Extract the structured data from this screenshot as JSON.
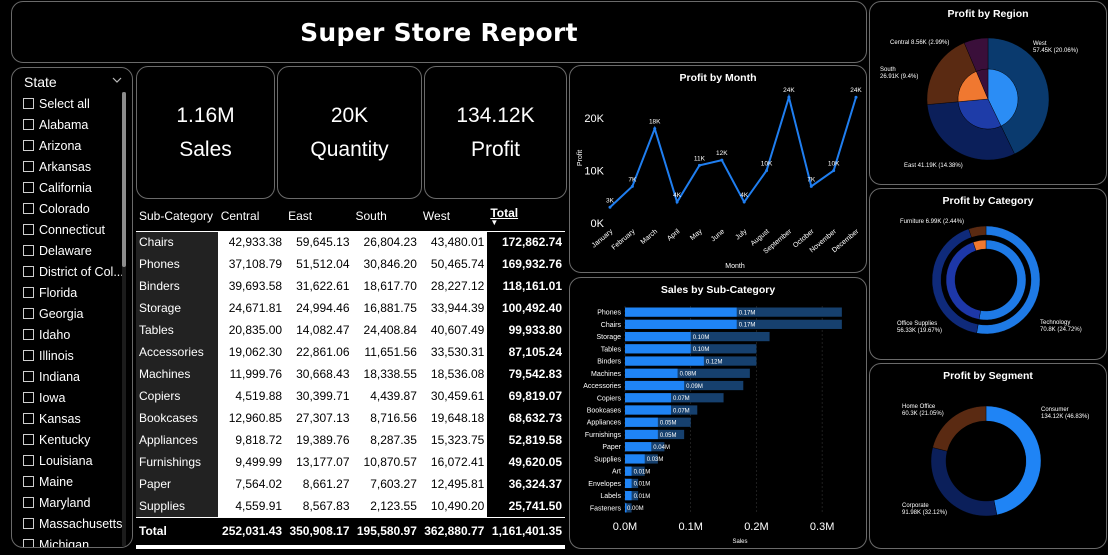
{
  "title": "Super Store Report",
  "slicer": {
    "header": "State",
    "items": [
      "Select all",
      "Alabama",
      "Arizona",
      "Arkansas",
      "California",
      "Colorado",
      "Connecticut",
      "Delaware",
      "District of Col...",
      "Florida",
      "Georgia",
      "Idaho",
      "Illinois",
      "Indiana",
      "Iowa",
      "Kansas",
      "Kentucky",
      "Louisiana",
      "Maine",
      "Maryland",
      "Massachusetts",
      "Michigan"
    ]
  },
  "kpis": {
    "sales": {
      "value": "1.16M",
      "label": "Sales"
    },
    "quantity": {
      "value": "20K",
      "label": "Quantity"
    },
    "profit": {
      "value": "134.12K",
      "label": "Profit"
    }
  },
  "matrix": {
    "headers": [
      "Sub-Category",
      "Central",
      "East",
      "South",
      "West",
      "Total"
    ],
    "rows": [
      [
        "Chairs",
        "42,933.38",
        "59,645.13",
        "26,804.23",
        "43,480.01",
        "172,862.74"
      ],
      [
        "Phones",
        "37,108.79",
        "51,512.04",
        "30,846.20",
        "50,465.74",
        "169,932.76"
      ],
      [
        "Binders",
        "39,693.58",
        "31,622.61",
        "18,617.70",
        "28,227.12",
        "118,161.01"
      ],
      [
        "Storage",
        "24,671.81",
        "24,994.46",
        "16,881.75",
        "33,944.39",
        "100,492.40"
      ],
      [
        "Tables",
        "20,835.00",
        "14,082.47",
        "24,408.84",
        "40,607.49",
        "99,933.80"
      ],
      [
        "Accessories",
        "19,062.30",
        "22,861.06",
        "11,651.56",
        "33,530.31",
        "87,105.24"
      ],
      [
        "Machines",
        "11,999.76",
        "30,668.43",
        "18,338.55",
        "18,536.08",
        "79,542.83"
      ],
      [
        "Copiers",
        "4,519.88",
        "30,399.71",
        "4,439.87",
        "30,459.61",
        "69,819.07"
      ],
      [
        "Bookcases",
        "12,960.85",
        "27,307.13",
        "8,716.56",
        "19,648.18",
        "68,632.73"
      ],
      [
        "Appliances",
        "9,818.72",
        "19,389.76",
        "8,287.35",
        "15,323.75",
        "52,819.58"
      ],
      [
        "Furnishings",
        "9,499.99",
        "13,177.07",
        "10,870.57",
        "16,072.41",
        "49,620.05"
      ],
      [
        "Paper",
        "7,564.02",
        "8,661.27",
        "7,603.27",
        "12,495.81",
        "36,324.37"
      ],
      [
        "Supplies",
        "4,559.91",
        "8,567.83",
        "2,123.55",
        "10,490.20",
        "25,741.50"
      ]
    ],
    "totals": [
      "Total",
      "252,031.43",
      "350,908.17",
      "195,580.97",
      "362,880.77",
      "1,161,401.35"
    ]
  },
  "charts": {
    "month": {
      "title": "Profit by Month",
      "xlabel": "Month",
      "ylabel": "Profit",
      "yticks": [
        "0K",
        "10K",
        "20K"
      ],
      "ymax": 25,
      "color": "#1f7ef0",
      "months": [
        "January",
        "February",
        "March",
        "April",
        "May",
        "June",
        "July",
        "August",
        "September",
        "October",
        "November",
        "December"
      ],
      "values": [
        3,
        7,
        18,
        4,
        11,
        12,
        4,
        10,
        24,
        7,
        10,
        24
      ],
      "labels": [
        "3K",
        "7K",
        "18K",
        "4K",
        "11K",
        "12K",
        "4K",
        "10K",
        "24K",
        "7K",
        "10K",
        "24K"
      ]
    },
    "subcat": {
      "title": "Sales by Sub-Category",
      "xlabel": "Sales",
      "xticks": [
        "0.0M",
        "0.1M",
        "0.2M",
        "0.3M"
      ],
      "xmax": 0.35,
      "color_sales": "#1f84f5",
      "color_profit": "#16406e",
      "categories": [
        "Phones",
        "Chairs",
        "Storage",
        "Tables",
        "Binders",
        "Machines",
        "Accessories",
        "Copiers",
        "Bookcases",
        "Appliances",
        "Furnishings",
        "Paper",
        "Supplies",
        "Art",
        "Envelopes",
        "Labels",
        "Fasteners"
      ],
      "sales": [
        0.17,
        0.17,
        0.1,
        0.1,
        0.12,
        0.08,
        0.09,
        0.07,
        0.07,
        0.05,
        0.05,
        0.04,
        0.03,
        0.01,
        0.01,
        0.01,
        0.0
      ],
      "labels": [
        "0.17M",
        "0.17M",
        "0.10M",
        "0.10M",
        "0.12M",
        "0.08M",
        "0.09M",
        "0.07M",
        "0.07M",
        "0.05M",
        "0.05M",
        "0.04M",
        "0.03M",
        "0.01M",
        "0.01M",
        "0.01M",
        "0.00M"
      ],
      "outer": [
        0.33,
        0.33,
        0.22,
        0.2,
        0.2,
        0.19,
        0.18,
        0.15,
        0.11,
        0.1,
        0.09,
        0.06,
        0.05,
        0.03,
        0.02,
        0.02,
        0.01
      ]
    },
    "region": {
      "title": "Profit by Region",
      "slices": [
        {
          "name": "West",
          "label1": "West",
          "label2": "57.45K (20.06%)",
          "pct": 20.06,
          "color": "#0a3a6e"
        },
        {
          "name": "East",
          "label1": "East 41.19K (14.38%)",
          "label2": "",
          "pct": 14.38,
          "color": "#0b1f5a"
        },
        {
          "name": "South",
          "label1": "South",
          "label2": "26.91K (9.4%)",
          "pct": 9.4,
          "color": "#5a2a12"
        },
        {
          "name": "Central",
          "label1": "Central 8.56K (2.99%)",
          "label2": "",
          "pct": 2.99,
          "color": "#3a0f3a"
        }
      ],
      "inner_colors": [
        "#2b8df5",
        "#1e3ca8",
        "#f07830",
        "#3a0f3a"
      ]
    },
    "category": {
      "title": "Profit by Category",
      "slices": [
        {
          "name": "Technology",
          "label1": "Technology",
          "label2": "70.8K (24.72%)",
          "pct": 24.72,
          "color": "#1e7ae6"
        },
        {
          "name": "Office Supplies",
          "label1": "Office Supplies",
          "label2": "56.33K (19.67%)",
          "pct": 19.67,
          "color": "#0f2a7a"
        },
        {
          "name": "Furniture",
          "label1": "Furniture 6.99K (2.44%)",
          "label2": "",
          "pct": 2.44,
          "color": "#5a2a12"
        }
      ],
      "inner_colors": [
        "#1e7ae6",
        "#1d37a8",
        "#f07830"
      ]
    },
    "segment": {
      "title": "Profit by Segment",
      "slices": [
        {
          "name": "Consumer",
          "label1": "Consumer",
          "label2": "134.12K (46.83%)",
          "pct": 46.83,
          "color": "#1f84f5"
        },
        {
          "name": "Corporate",
          "label1": "Corporate",
          "label2": "91.98K (32.12%)",
          "pct": 32.12,
          "color": "#0b1f5a"
        },
        {
          "name": "Home Office",
          "label1": "Home Office",
          "label2": "60.3K (21.05%)",
          "pct": 21.05,
          "color": "#5a2a12"
        }
      ]
    }
  }
}
